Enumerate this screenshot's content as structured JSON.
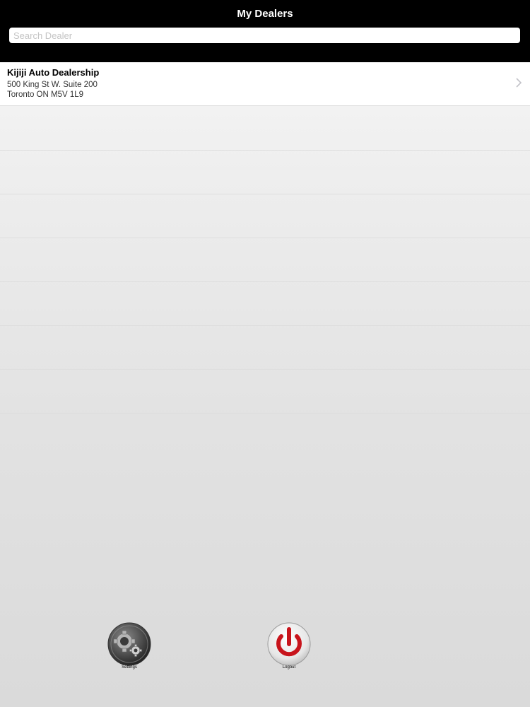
{
  "header": {
    "title": "My Dealers"
  },
  "search": {
    "placeholder": "Search Dealer",
    "value": ""
  },
  "dealers": [
    {
      "name": "Kijiji Auto Dealership",
      "address_line1": "500 King St W. Suite 200",
      "address_line2": "Toronto ON M5V 1L9"
    }
  ],
  "toolbar": {
    "settings_label": "Settings",
    "settings_icon": "gear-icon",
    "logout_label": "Logout",
    "logout_icon": "power-icon",
    "logout_color": "#c8141c"
  }
}
